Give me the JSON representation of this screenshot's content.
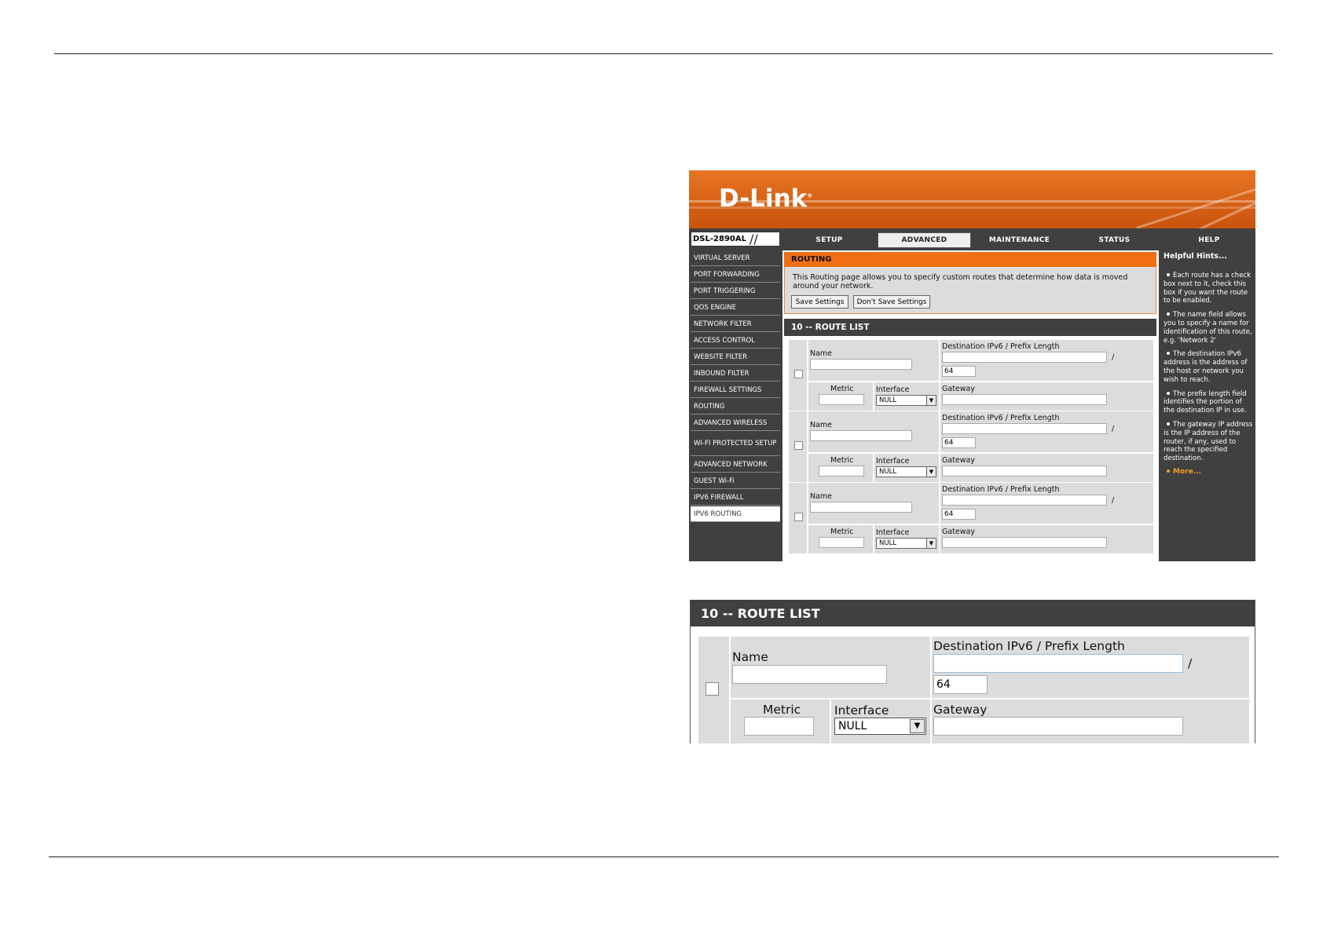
{
  "router": {
    "brand": "D-Link",
    "model": "DSL-2890AL",
    "tabs": [
      "SETUP",
      "ADVANCED",
      "MAINTENANCE",
      "STATUS",
      "HELP"
    ],
    "active_tab": "ADVANCED",
    "left_nav": [
      "VIRTUAL SERVER",
      "PORT FORWARDING",
      "PORT TRIGGERING",
      "QOS ENGINE",
      "NETWORK FILTER",
      "ACCESS CONTROL",
      "WEBSITE FILTER",
      "INBOUND FILTER",
      "FIREWALL SETTINGS",
      "ROUTING",
      "ADVANCED WIRELESS",
      "WI-FI PROTECTED SETUP",
      "ADVANCED NETWORK",
      "GUEST Wi-Fi",
      "IPV6 FIREWALL",
      "IPV6 ROUTING"
    ],
    "selected_nav": "IPV6 ROUTING",
    "routing": {
      "title": "ROUTING",
      "description": "This Routing page allows you to specify custom routes that determine how data is moved around your network.",
      "save_label": "Save Settings",
      "dont_save_label": "Don't Save Settings"
    },
    "route_list": {
      "title": "10 -- ROUTE LIST",
      "labels": {
        "name": "Name",
        "destination": "Destination IPv6 / Prefix Length",
        "slash": "/",
        "metric": "Metric",
        "interface": "Interface",
        "gateway": "Gateway"
      },
      "rows": [
        {
          "prefix": "64",
          "interface": "NULL"
        },
        {
          "prefix": "64",
          "interface": "NULL"
        },
        {
          "prefix": "64",
          "interface": "NULL"
        }
      ]
    },
    "help": {
      "title": "Helpful Hints...",
      "hints": [
        "Each route has a check box next to it, check this box if you want the route to be enabled.",
        "The name field allows you to specify a name for identification of this route, e.g. 'Network 2'",
        "The destination IPv6 address is the address of the host or network you wish to reach.",
        "The prefix length field identifies the portion of the destination IP in use.",
        "The gateway IP address is the IP address of the router, if any, used to reach the specified destination."
      ],
      "more": "More..."
    }
  },
  "zoom": {
    "title": "10 -- ROUTE LIST",
    "name": "Name",
    "destination": "Destination IPv6 / Prefix Length",
    "slash": "/",
    "prefix": "64",
    "metric": "Metric",
    "interface": "Interface",
    "interface_value": "NULL",
    "gateway": "Gateway"
  }
}
